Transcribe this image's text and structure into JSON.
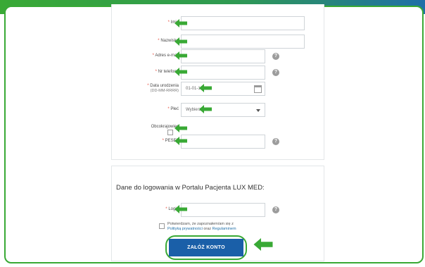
{
  "form": {
    "imie_label": "Imię",
    "nazwisko_label": "Nazwisko",
    "email_label": "Adres e-mail",
    "phone_label": "Nr telefonu",
    "dob_label": "Data urodzenia",
    "dob_hint": "(DD-MM-RRRR)",
    "dob_value": "01-01-1900",
    "gender_label": "Płeć",
    "gender_value": "Wybierz",
    "foreigner_label": "Obcokrajowiec",
    "pesel_label": "PESEL",
    "required_mark": "*",
    "help_glyph": "?"
  },
  "login": {
    "title": "Dane do logowania w Portalu Pacjenta LUX MED:",
    "login_label": "Login",
    "consent_text": "Potwierdzam, że zapoznałem/am się z",
    "privacy_link": "Polityką prywatności",
    "and_text": "oraz",
    "terms_link": "Regulaminem",
    "submit_label": "ZAŁÓŻ KONTO"
  },
  "colors": {
    "accent_green": "#39a935",
    "button_blue": "#1a5fa8",
    "required_red": "#e74c3c"
  },
  "icons": [
    "green-arrow-left-icon",
    "help-icon",
    "calendar-icon",
    "chevron-down-icon"
  ]
}
